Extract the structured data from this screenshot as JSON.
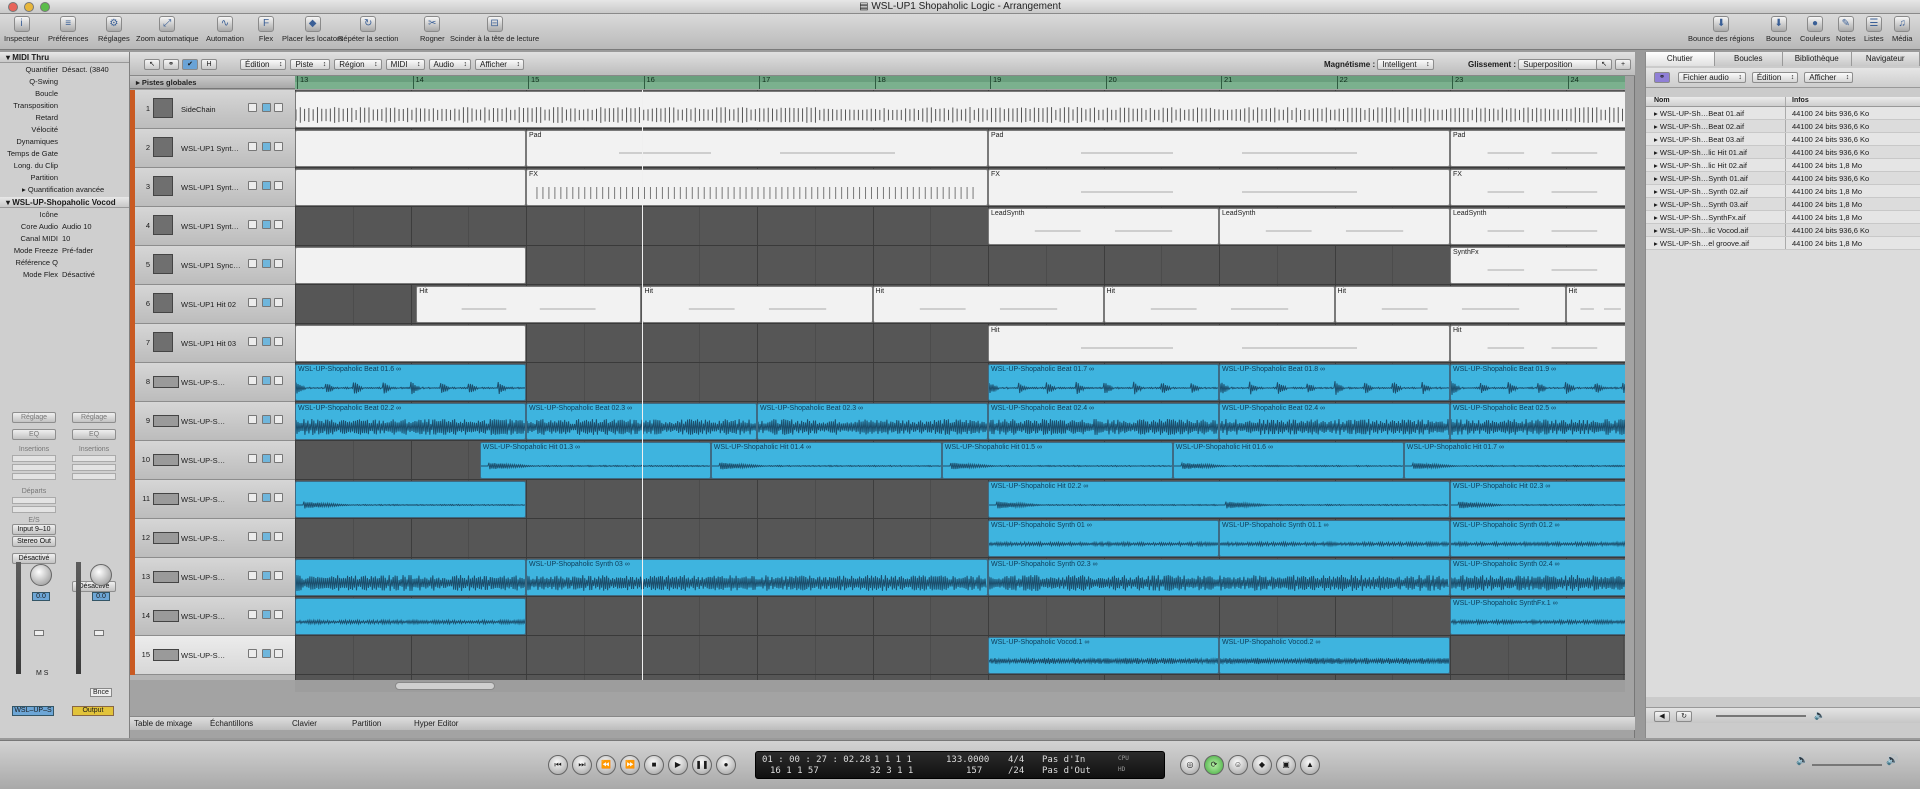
{
  "window": {
    "title": "WSL-UP1 Shopaholic Logic - Arrangement"
  },
  "toolbar": {
    "left": [
      {
        "label": "Inspecteur",
        "icon": "i"
      },
      {
        "label": "Préférences",
        "icon": "≡"
      },
      {
        "label": "Réglages",
        "icon": "⚙"
      },
      {
        "label": "Zoom automatique",
        "icon": "⤢"
      },
      {
        "label": "Automation",
        "icon": "∿"
      },
      {
        "label": "Flex",
        "icon": "F"
      },
      {
        "label": "Placer les locators",
        "icon": "◆"
      },
      {
        "label": "Répéter la section",
        "icon": "↻"
      },
      {
        "label": "Rogner",
        "icon": "✂"
      },
      {
        "label": "Scinder à la tête de lecture",
        "icon": "⊟"
      }
    ],
    "right": [
      {
        "label": "Bounce des régions",
        "icon": "⬇"
      },
      {
        "label": "Bounce",
        "icon": "⬇"
      },
      {
        "label": "Couleurs",
        "icon": "●"
      },
      {
        "label": "Notes",
        "icon": "✎"
      },
      {
        "label": "Listes",
        "icon": "☰"
      },
      {
        "label": "Média",
        "icon": "♫"
      }
    ]
  },
  "inspector": {
    "section1": "MIDI Thru",
    "rows": [
      {
        "k": "Quantifier",
        "v": "Désact. (3840"
      },
      {
        "k": "Q-Swing",
        "v": ""
      },
      {
        "k": "Boucle",
        "v": ""
      },
      {
        "k": "Transposition",
        "v": ""
      },
      {
        "k": "Retard",
        "v": ""
      },
      {
        "k": "Vélocité",
        "v": ""
      },
      {
        "k": "Dynamiques",
        "v": ""
      },
      {
        "k": "Temps de Gate",
        "v": ""
      },
      {
        "k": "Long. du Clip",
        "v": ""
      },
      {
        "k": "Partition",
        "v": ""
      }
    ],
    "quantif": "Quantification avancée",
    "section2": "WSL-UP-Shopaholic Vocod",
    "rows2": [
      {
        "k": "Icône",
        "v": ""
      },
      {
        "k": "Core Audio",
        "v": "Audio 10"
      },
      {
        "k": "Canal MIDI",
        "v": "10"
      },
      {
        "k": "Mode Freeze",
        "v": "Pré-fader"
      },
      {
        "k": "Référence Q",
        "v": ""
      },
      {
        "k": "Mode Flex",
        "v": "Désactivé"
      }
    ],
    "strip1": {
      "setting": "Réglage",
      "eq": "EQ",
      "inserts": "Insertions",
      "sends": "Départs",
      "io": "E/S",
      "input": "Input 9–10",
      "output": "Stereo Out",
      "auto": "Désactivé",
      "value": "0.0",
      "name": "WSL–UP–S"
    },
    "strip2": {
      "setting": "Réglage",
      "eq": "EQ",
      "inserts": "Insertions",
      "auto": "Désactivé",
      "value": "0.0",
      "bounce": "Bnce",
      "name": "Output"
    }
  },
  "localmenu": {
    "menus": [
      "Édition",
      "Piste",
      "Région",
      "MIDI",
      "Audio",
      "Afficher"
    ],
    "snap_label": "Magnétisme :",
    "snap_value": "Intelligent",
    "drag_label": "Glissement :",
    "drag_value": "Superposition"
  },
  "tracks_header": "Pistes globales",
  "ruler": [
    "13",
    "14",
    "15",
    "16",
    "17",
    "18",
    "19",
    "20",
    "21",
    "22",
    "23",
    "24"
  ],
  "tracks": [
    {
      "n": "1",
      "name": "SideChain",
      "type": "m"
    },
    {
      "n": "2",
      "name": "WSL-UP1 Synt…",
      "type": "m"
    },
    {
      "n": "3",
      "name": "WSL-UP1 Synt…",
      "type": "m"
    },
    {
      "n": "4",
      "name": "WSL-UP1 Synt…",
      "type": "m"
    },
    {
      "n": "5",
      "name": "WSL-UP1 Sync…",
      "type": "m"
    },
    {
      "n": "6",
      "name": "WSL-UP1 Hit 02",
      "type": "m"
    },
    {
      "n": "7",
      "name": "WSL-UP1 Hit 03",
      "type": "m"
    },
    {
      "n": "8",
      "name": "WSL-UP-S…",
      "type": "a"
    },
    {
      "n": "9",
      "name": "WSL-UP-S…",
      "type": "a"
    },
    {
      "n": "10",
      "name": "WSL-UP-S…",
      "type": "a"
    },
    {
      "n": "11",
      "name": "WSL-UP-S…",
      "type": "a"
    },
    {
      "n": "12",
      "name": "WSL-UP-S…",
      "type": "a"
    },
    {
      "n": "13",
      "name": "WSL-UP-S…",
      "type": "a"
    },
    {
      "n": "14",
      "name": "WSL-UP-S…",
      "type": "a"
    },
    {
      "n": "15",
      "name": "WSL-UP-S…",
      "type": "a"
    }
  ],
  "regions": [
    {
      "t": 0,
      "s": 13,
      "e": 24.6,
      "k": "m",
      "l": "",
      "w": "comb"
    },
    {
      "t": 1,
      "s": 13,
      "e": 15,
      "k": "m",
      "l": ""
    },
    {
      "t": 1,
      "s": 15,
      "e": 19,
      "k": "m",
      "l": "Pad"
    },
    {
      "t": 1,
      "s": 19,
      "e": 23,
      "k": "m",
      "l": "Pad"
    },
    {
      "t": 1,
      "s": 23,
      "e": 24.6,
      "k": "m",
      "l": "Pad"
    },
    {
      "t": 2,
      "s": 13,
      "e": 15,
      "k": "m",
      "l": ""
    },
    {
      "t": 2,
      "s": 15,
      "e": 19,
      "k": "m",
      "l": "FX",
      "w": "ticks"
    },
    {
      "t": 2,
      "s": 19,
      "e": 23,
      "k": "m",
      "l": "FX"
    },
    {
      "t": 2,
      "s": 23,
      "e": 24.6,
      "k": "m",
      "l": "FX"
    },
    {
      "t": 3,
      "s": 19,
      "e": 21,
      "k": "m",
      "l": "LeadSynth"
    },
    {
      "t": 3,
      "s": 21,
      "e": 23,
      "k": "m",
      "l": "LeadSynth"
    },
    {
      "t": 3,
      "s": 23,
      "e": 24.6,
      "k": "m",
      "l": "LeadSynth"
    },
    {
      "t": 4,
      "s": 13,
      "e": 15,
      "k": "m",
      "l": ""
    },
    {
      "t": 4,
      "s": 23,
      "e": 24.6,
      "k": "m",
      "l": "SynthFx"
    },
    {
      "t": 5,
      "s": 14.05,
      "e": 16,
      "k": "m",
      "l": "Hit"
    },
    {
      "t": 5,
      "s": 16,
      "e": 18,
      "k": "m",
      "l": "Hit"
    },
    {
      "t": 5,
      "s": 18,
      "e": 20,
      "k": "m",
      "l": "Hit"
    },
    {
      "t": 5,
      "s": 20,
      "e": 22,
      "k": "m",
      "l": "Hit"
    },
    {
      "t": 5,
      "s": 22,
      "e": 24,
      "k": "m",
      "l": "Hit"
    },
    {
      "t": 5,
      "s": 24,
      "e": 24.6,
      "k": "m",
      "l": "Hit"
    },
    {
      "t": 6,
      "s": 13,
      "e": 15,
      "k": "m",
      "l": ""
    },
    {
      "t": 6,
      "s": 19,
      "e": 23,
      "k": "m",
      "l": "Hit"
    },
    {
      "t": 6,
      "s": 23,
      "e": 24.6,
      "k": "m",
      "l": "Hit"
    },
    {
      "t": 7,
      "s": 13,
      "e": 15,
      "k": "a",
      "l": "WSL-UP-Shopaholic Beat 01.6 ∞",
      "w": "beat"
    },
    {
      "t": 7,
      "s": 19,
      "e": 21,
      "k": "a",
      "l": "WSL-UP-Shopaholic Beat 01.7 ∞",
      "w": "beat"
    },
    {
      "t": 7,
      "s": 21,
      "e": 23,
      "k": "a",
      "l": "WSL-UP-Shopaholic Beat 01.8 ∞",
      "w": "beat"
    },
    {
      "t": 7,
      "s": 23,
      "e": 24.6,
      "k": "a",
      "l": "WSL-UP-Shopaholic Beat 01.9 ∞",
      "w": "beat"
    },
    {
      "t": 8,
      "s": 13,
      "e": 15,
      "k": "a",
      "l": "WSL-UP-Shopaholic Beat 02.2 ∞",
      "w": "dense"
    },
    {
      "t": 8,
      "s": 15,
      "e": 17,
      "k": "a",
      "l": "WSL-UP-Shopaholic Beat 02.3 ∞",
      "w": "dense"
    },
    {
      "t": 8,
      "s": 17,
      "e": 19,
      "k": "a",
      "l": "WSL-UP-Shopaholic Beat 02.3 ∞",
      "w": "dense"
    },
    {
      "t": 8,
      "s": 19,
      "e": 21,
      "k": "a",
      "l": "WSL-UP-Shopaholic Beat 02.4 ∞",
      "w": "dense"
    },
    {
      "t": 8,
      "s": 21,
      "e": 23,
      "k": "a",
      "l": "WSL-UP-Shopaholic Beat 02.4 ∞",
      "w": "dense"
    },
    {
      "t": 8,
      "s": 23,
      "e": 24.6,
      "k": "a",
      "l": "WSL-UP-Shopaholic Beat 02.5 ∞",
      "w": "dense"
    },
    {
      "t": 9,
      "s": 14.6,
      "e": 16.6,
      "k": "a",
      "l": "WSL-UP-Shopaholic Hit 01.3 ∞",
      "w": "hit"
    },
    {
      "t": 9,
      "s": 16.6,
      "e": 18.6,
      "k": "a",
      "l": "WSL-UP-Shopaholic Hit 01.4 ∞",
      "w": "hit"
    },
    {
      "t": 9,
      "s": 18.6,
      "e": 20.6,
      "k": "a",
      "l": "WSL-UP-Shopaholic Hit 01.5 ∞",
      "w": "hit"
    },
    {
      "t": 9,
      "s": 20.6,
      "e": 22.6,
      "k": "a",
      "l": "WSL-UP-Shopaholic Hit 01.6 ∞",
      "w": "hit"
    },
    {
      "t": 9,
      "s": 22.6,
      "e": 24.6,
      "k": "a",
      "l": "WSL-UP-Shopaholic Hit 01.7 ∞",
      "w": "hit"
    },
    {
      "t": 10,
      "s": 13,
      "e": 15,
      "k": "a",
      "l": "",
      "w": "hit"
    },
    {
      "t": 10,
      "s": 19,
      "e": 23,
      "k": "a",
      "l": "WSL-UP-Shopaholic Hit 02.2 ∞",
      "w": "hit"
    },
    {
      "t": 10,
      "s": 23,
      "e": 24.6,
      "k": "a",
      "l": "WSL-UP-Shopaholic Hit 02.3 ∞",
      "w": "hit"
    },
    {
      "t": 11,
      "s": 19,
      "e": 21,
      "k": "a",
      "l": "WSL-UP-Shopaholic Synth 01 ∞",
      "w": "flat"
    },
    {
      "t": 11,
      "s": 21,
      "e": 23,
      "k": "a",
      "l": "WSL-UP-Shopaholic Synth 01.1 ∞",
      "w": "flat"
    },
    {
      "t": 11,
      "s": 23,
      "e": 24.6,
      "k": "a",
      "l": "WSL-UP-Shopaholic Synth 01.2 ∞",
      "w": "flat"
    },
    {
      "t": 12,
      "s": 13,
      "e": 15,
      "k": "a",
      "l": "",
      "w": "dense"
    },
    {
      "t": 12,
      "s": 15,
      "e": 19,
      "k": "a",
      "l": "WSL-UP-Shopaholic Synth 03 ∞",
      "w": "dense"
    },
    {
      "t": 12,
      "s": 19,
      "e": 23,
      "k": "a",
      "l": "WSL-UP-Shopaholic Synth 02.3 ∞",
      "w": "dense"
    },
    {
      "t": 12,
      "s": 23,
      "e": 24.6,
      "k": "a",
      "l": "WSL-UP-Shopaholic Synth 02.4 ∞",
      "w": "dense"
    },
    {
      "t": 13,
      "s": 13,
      "e": 15,
      "k": "a",
      "l": "",
      "w": "flat"
    },
    {
      "t": 13,
      "s": 23,
      "e": 24.6,
      "k": "a",
      "l": "WSL-UP-Shopaholic SynthFx.1 ∞",
      "w": "flat"
    },
    {
      "t": 14,
      "s": 19,
      "e": 21,
      "k": "a",
      "l": "WSL-UP-Shopaholic Vocod.1 ∞",
      "w": "voc"
    },
    {
      "t": 14,
      "s": 21,
      "e": 23,
      "k": "a",
      "l": "WSL-UP-Shopaholic Vocod.2 ∞",
      "w": "voc"
    }
  ],
  "playhead_bar": 16,
  "bottom_tabs": [
    "Table de mixage",
    "Échantillons",
    "Clavier",
    "Partition",
    "Hyper Editor"
  ],
  "browser": {
    "tabs": [
      "Chutier",
      "Boucles",
      "Bibliothèque",
      "Navigateur"
    ],
    "menus": [
      "Fichier audio",
      "Édition",
      "Afficher"
    ],
    "col_name": "Nom",
    "col_info": "Infos",
    "files": [
      {
        "n": "WSL-UP-Sh…Beat 01.aif",
        "i": "44100  24 bits  936,6 Ko"
      },
      {
        "n": "WSL-UP-Sh…Beat 02.aif",
        "i": "44100  24 bits  936,6 Ko"
      },
      {
        "n": "WSL-UP-Sh…Beat 03.aif",
        "i": "44100  24 bits  936,6 Ko"
      },
      {
        "n": "WSL-UP-Sh…lic Hit 01.aif",
        "i": "44100  24 bits  936,6 Ko"
      },
      {
        "n": "WSL-UP-Sh…lic Hit 02.aif",
        "i": "44100  24 bits  1,8 Mo"
      },
      {
        "n": "WSL-UP-Sh…Synth 01.aif",
        "i": "44100  24 bits  936,6 Ko"
      },
      {
        "n": "WSL-UP-Sh…Synth 02.aif",
        "i": "44100  24 bits  1,8 Mo"
      },
      {
        "n": "WSL-UP-Sh…Synth 03.aif",
        "i": "44100  24 bits  1,8 Mo"
      },
      {
        "n": "WSL-UP-Sh…SynthFx.aif",
        "i": "44100  24 bits  1,8 Mo"
      },
      {
        "n": "WSL-UP-Sh…lic Vocod.aif",
        "i": "44100  24 bits  936,6 Ko"
      },
      {
        "n": "WSL-UP-Sh…el groove.aif",
        "i": "44100  24 bits  1,8 Mo"
      }
    ]
  },
  "transport": {
    "smpte": "01 : 00 : 27 : 02.28",
    "bars": "1    1    1    1",
    "tempo": "133.0000",
    "sig": "4/4",
    "in": "Pas d'In",
    "bars2": "16    1    1    57",
    "bars3": "32    3    1    1",
    "div": "157",
    "div2": "/24",
    "out": "Pas d'Out",
    "cpu": "CPU",
    "hd": "HD"
  }
}
